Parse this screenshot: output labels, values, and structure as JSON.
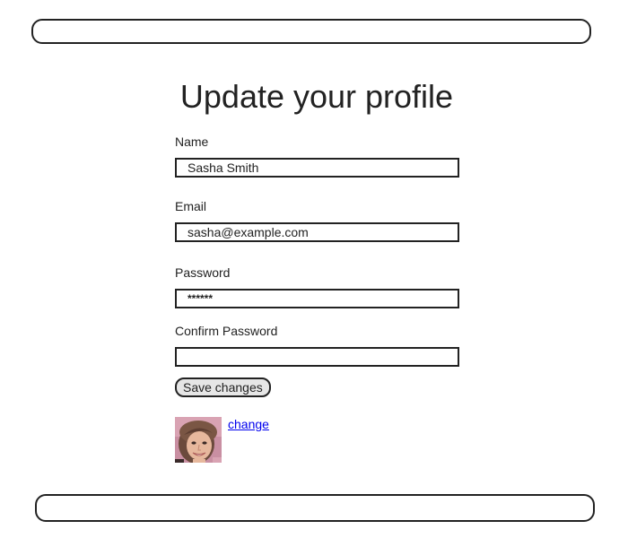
{
  "page": {
    "title": "Update your profile"
  },
  "form": {
    "name": {
      "label": "Name",
      "value": "Sasha Smith",
      "placeholder": ""
    },
    "email": {
      "label": "Email",
      "value": "sasha@example.com",
      "placeholder": ""
    },
    "password": {
      "label": "Password",
      "value": "******",
      "placeholder": ""
    },
    "confirm_password": {
      "label": "Confirm Password",
      "value": "",
      "placeholder": ""
    },
    "save_label": "Save changes"
  },
  "avatar": {
    "change_label": "change",
    "icon": "user-photo"
  },
  "colors": {
    "border": "#222222",
    "button_bg": "#e6e6e6",
    "link": "#0000ee"
  }
}
